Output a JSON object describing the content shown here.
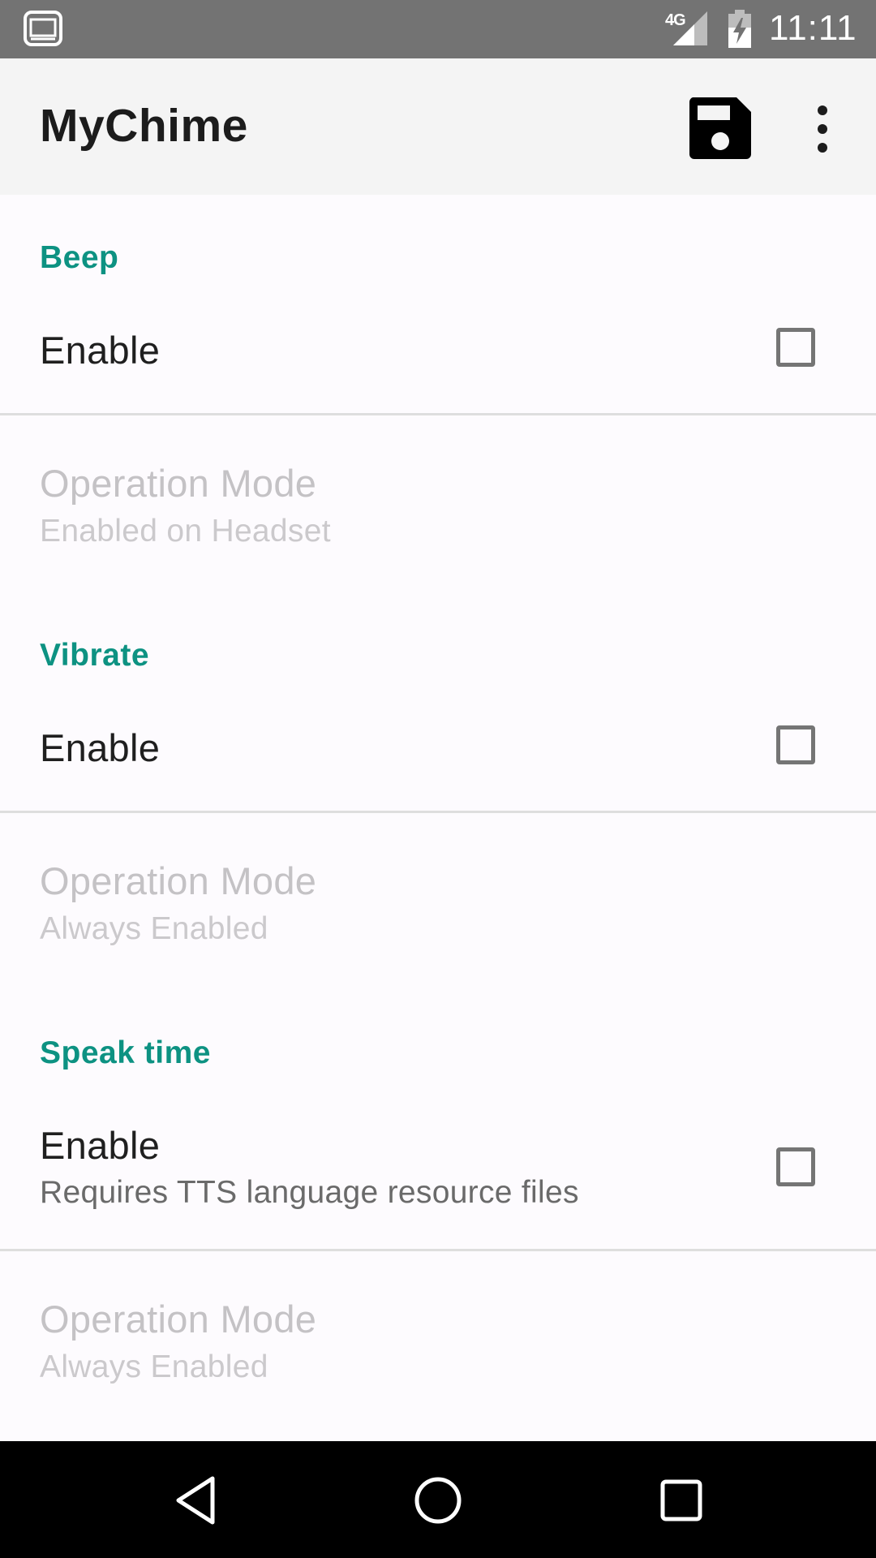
{
  "status_bar": {
    "network": "4G",
    "time": "11:11"
  },
  "app_bar": {
    "title": "MyChime",
    "save_icon": "save-floppy-icon",
    "overflow_icon": "more-vert-icon"
  },
  "sections": [
    {
      "category": "Beep",
      "enable": {
        "title": "Enable",
        "summary": "",
        "checked": false
      },
      "mode": {
        "title": "Operation Mode",
        "summary": "Enabled on Headset",
        "enabled": false
      }
    },
    {
      "category": "Vibrate",
      "enable": {
        "title": "Enable",
        "summary": "",
        "checked": false
      },
      "mode": {
        "title": "Operation Mode",
        "summary": "Always Enabled",
        "enabled": false
      }
    },
    {
      "category": "Speak time",
      "enable": {
        "title": "Enable",
        "summary": "Requires TTS language resource files",
        "checked": false
      },
      "mode": {
        "title": "Operation Mode",
        "summary": "Always Enabled",
        "enabled": false
      }
    }
  ],
  "colors": {
    "accent": "#0d9282",
    "status_bar": "#737373",
    "app_bar": "#f4f4f4",
    "nav_bar": "#000000"
  }
}
